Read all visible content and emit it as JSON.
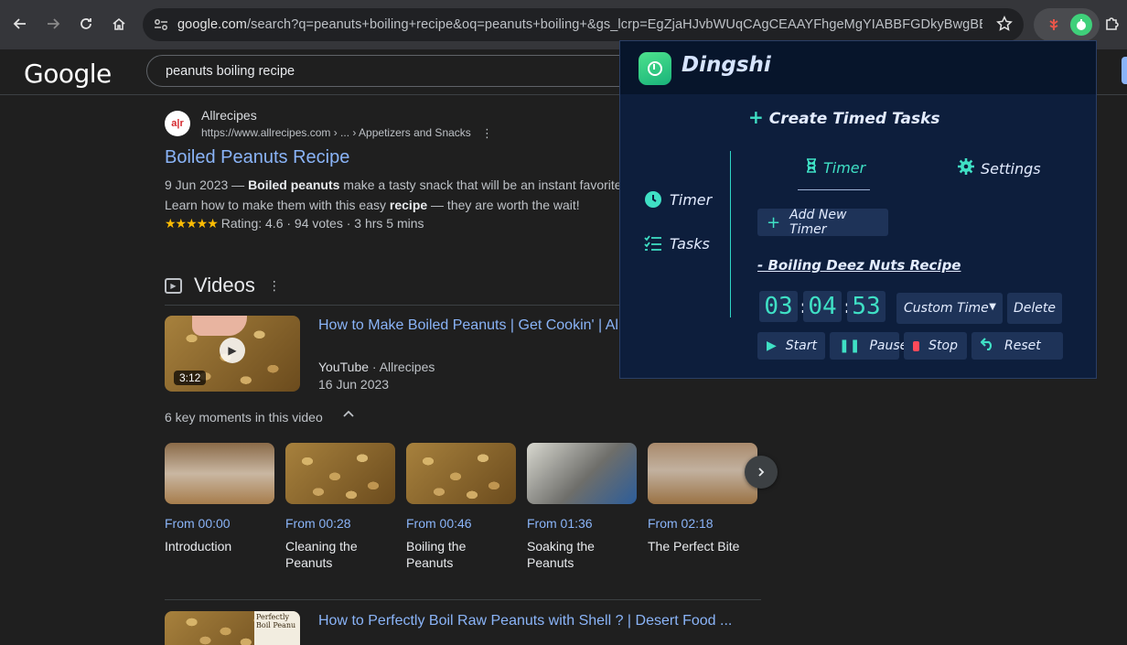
{
  "browser": {
    "url_main": "google.com",
    "url_rest": "/search?q=peanuts+boiling+recipe&oq=peanuts+boiling+&gs_lcrp=EgZjaHJvbWUqCAgCEAAYFhgeMgYIABBFGDkyBwgBEAAY..."
  },
  "google": {
    "logo": "Google",
    "query": "peanuts boiling recipe"
  },
  "result": {
    "favicon_text": "a|r",
    "site_name": "Allrecipes",
    "site_url": "https://www.allrecipes.com › ... › Appetizers and Snacks",
    "title": "Boiled Peanuts Recipe",
    "snippet_date": "9 Jun 2023 — ",
    "snippet_bold1": "Boiled peanuts",
    "snippet_rest1": " make a tasty snack that will be an instant favorite",
    "snippet_line2a": "Learn how to make them with this easy ",
    "snippet_bold2": "recipe",
    "snippet_line2b": " — they are worth the wait!",
    "stars": "★★★★★",
    "rating_text": "Rating: 4.6 · 94 votes · 3 hrs 5 mins",
    "rating_value": 4.6
  },
  "videos": {
    "heading": "Videos",
    "video1": {
      "title": "How to Make Boiled Peanuts | Get Cookin' | All",
      "duration": "3:12",
      "platform": "YouTube",
      "channel": "Allrecipes",
      "date": "16 Jun 2023"
    },
    "moments_heading": "6 key moments in this video",
    "moments": [
      {
        "time": "From 00:00",
        "label": "Introduction"
      },
      {
        "time": "From 00:28",
        "label": "Cleaning the Peanuts"
      },
      {
        "time": "From 00:46",
        "label": "Boiling the Peanuts"
      },
      {
        "time": "From 01:36",
        "label": "Soaking the Peanuts"
      },
      {
        "time": "From 02:18",
        "label": "The Perfect Bite"
      }
    ],
    "video2": {
      "title": "How to Perfectly Boil Raw Peanuts with Shell ? | Desert Food ...",
      "thumb_text": "Perfectly Boil Peanu"
    }
  },
  "dingshi": {
    "title": "Dingshi",
    "create": "Create Timed Tasks",
    "side_timer": "Timer",
    "side_tasks": "Tasks",
    "tab_timer": "Timer",
    "tab_settings": "Settings",
    "add_timer": "Add New Timer",
    "task_name": "- Boiling Deez Nuts Recipe",
    "hours": "03",
    "minutes": "04",
    "seconds": "53",
    "select_value": "Custom Time",
    "delete": "Delete",
    "start": "Start",
    "pause": "Pause",
    "stop": "Stop",
    "reset": "Reset",
    "accent": "#3fe0c5",
    "bg": "#0d1e3c"
  },
  "icons": [
    "back-icon",
    "forward-icon",
    "reload-icon",
    "home-icon",
    "site-settings-icon",
    "bookmark-star-icon",
    "extension-puzzle-icon",
    "play-icon",
    "chevron-up-icon",
    "chevron-right-icon",
    "clock-icon",
    "list-check-icon",
    "hourglass-icon",
    "gear-icon",
    "plus-icon",
    "pause-icon",
    "stop-icon",
    "undo-icon"
  ]
}
